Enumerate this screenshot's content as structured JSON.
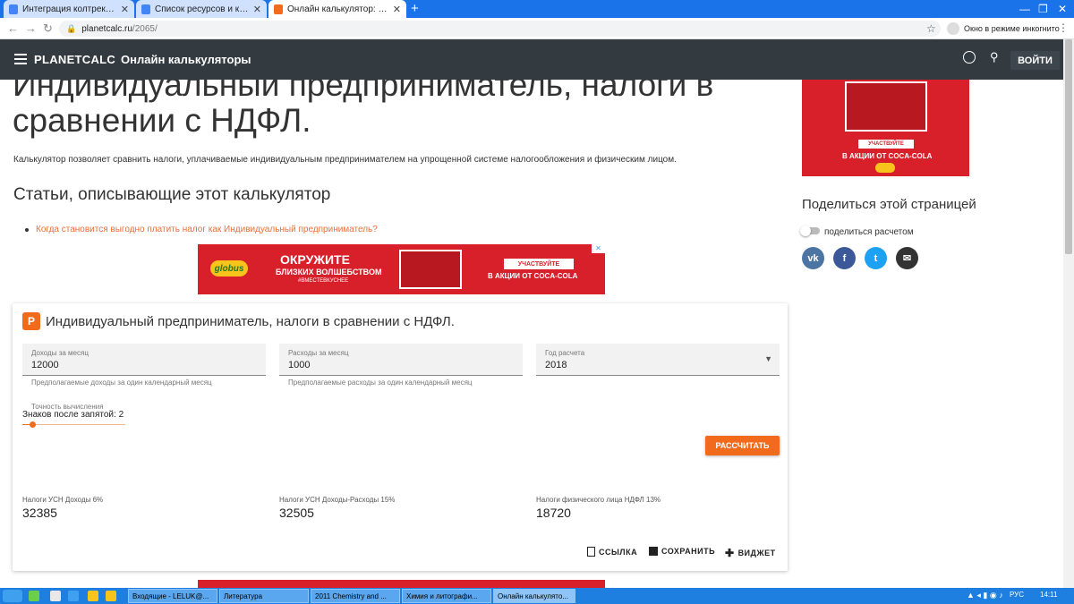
{
  "browser": {
    "tabs": [
      {
        "title": "Интеграция колтрекинга и скв",
        "icon": "docs-icon"
      },
      {
        "title": "Список ресурсов и калькулятор",
        "icon": "docs-icon"
      },
      {
        "title": "Онлайн калькулятор: Индивиду",
        "icon": "planetcalc-icon"
      }
    ],
    "url_host": "planetcalc.ru",
    "url_path": "/2065/",
    "incognito_label": "Окно в режиме инкогнито"
  },
  "header": {
    "brand": "PLANETCALC",
    "subtitle": "Онлайн калькуляторы",
    "login_label": "ВОЙТИ"
  },
  "page": {
    "title": "Индивидуальный предприниматель, налоги в сравнении с НДФЛ.",
    "description": "Калькулятор позволяет сравнить налоги, уплачиваемые индивидуальным предпринимателем на упрощенной системе налогообложения и физическим лицом.",
    "articles_heading": "Статьи, описывающие этот калькулятор",
    "article_link": "Когда становится выгодно платить налог как Индивидуальный предприниматель?"
  },
  "ad": {
    "brand": "globus",
    "headline": "ОКРУЖИТЕ",
    "subline": "БЛИЗКИХ ВОЛШЕБСТВОМ",
    "hashtag": "#ВМЕСТЕВКУСНЕЕ",
    "cta": "УЧАСТВУЙТЕ",
    "cta_sub": "В АКЦИИ ОТ COCA-COLA"
  },
  "calculator": {
    "title": "Индивидуальный предприниматель, налоги в сравнении с НДФЛ.",
    "income_label": "Доходы за месяц",
    "income_value": "12000",
    "income_hint": "Предполагаемые доходы за один календарный месяц",
    "expense_label": "Расходы за месяц",
    "expense_value": "1000",
    "expense_hint": "Предполагаемые расходы за один календарный месяц",
    "year_label": "Год расчета",
    "year_value": "2018",
    "precision_label": "Точность вычисления",
    "precision_value": "Знаков после запятой: 2",
    "precision_level": 2,
    "calc_button": "РАССЧИТАТЬ",
    "results": [
      {
        "label": "Налоги УСН Доходы 6%",
        "value": "32385"
      },
      {
        "label": "Налоги УСН Доходы-Расходы 15%",
        "value": "32505"
      },
      {
        "label": "Налоги физического лица НДФЛ 13%",
        "value": "18720"
      }
    ],
    "actions": {
      "link": "ССЫЛКА",
      "save": "СОХРАНИТЬ",
      "widget": "ВИДЖЕТ"
    }
  },
  "sidebar": {
    "share_heading": "Поделиться этой страницей",
    "share_toggle_label": "поделиться расчетом",
    "social": [
      "vk-icon",
      "facebook-icon",
      "twitter-icon",
      "email-icon"
    ]
  },
  "taskbar": {
    "items": [
      "Входящие - LELUK@...",
      "Литература",
      "2011 Chemistry and ...",
      "Химия и литографи...",
      "Онлайн калькулято..."
    ],
    "lang": "РУС",
    "time": "14:11"
  },
  "colors": {
    "accent": "#f26b1d",
    "link": "#e8703a",
    "appbar": "#333a40",
    "chrome": "#1a73e8"
  }
}
